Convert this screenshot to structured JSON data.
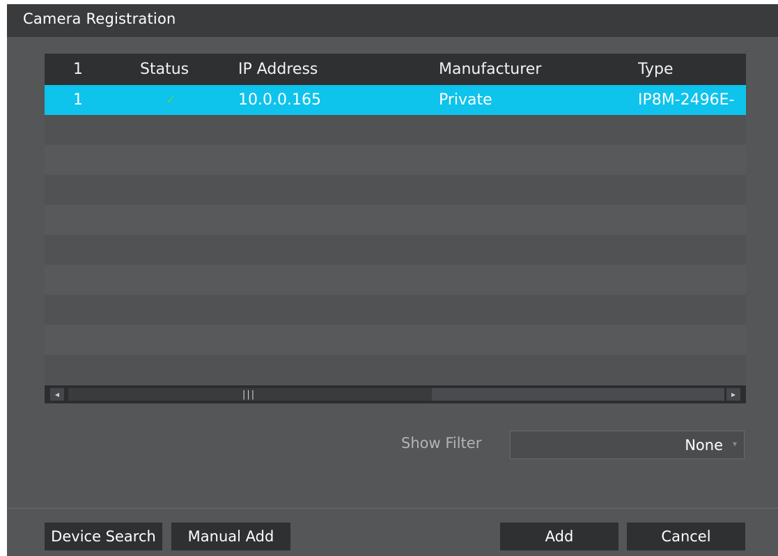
{
  "window": {
    "title": "Camera Registration"
  },
  "table": {
    "headers": {
      "index": "1",
      "status": "Status",
      "ip": "IP Address",
      "manufacturer": "Manufacturer",
      "type": "Type"
    },
    "rows": [
      {
        "index": "1",
        "status_icon": "check-icon",
        "status_glyph": "✓",
        "ip": "10.0.0.165",
        "manufacturer": "Private",
        "type": "IP8M-2496E-"
      }
    ],
    "selected_row_color": "#0ec3ec"
  },
  "scrollbar": {
    "left_arrow": "◂",
    "right_arrow": "▸",
    "grip": "|||"
  },
  "filter": {
    "label": "Show Filter",
    "value": "None",
    "caret": "▾"
  },
  "buttons": {
    "device_search": "Device Search",
    "manual_add": "Manual Add",
    "add": "Add",
    "cancel": "Cancel"
  }
}
